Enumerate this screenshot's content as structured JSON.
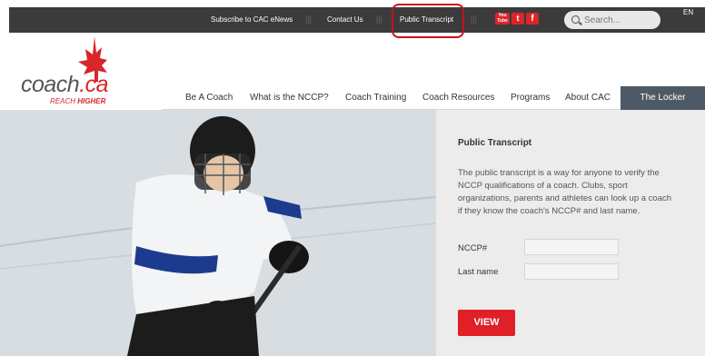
{
  "topbar": {
    "subscribe": "Subscribe to CAC eNews",
    "contact": "Contact Us",
    "transcript": "Public Transcript",
    "separator": "|||",
    "youtube": "You Tube",
    "twitter": "t",
    "facebook": "f",
    "search_placeholder": "Search...",
    "language": "EN"
  },
  "logo": {
    "word": "coach",
    "suffix": ".ca",
    "tag_a": "REACH ",
    "tag_b": "HIGHER"
  },
  "nav": [
    "Be A Coach",
    "What is the NCCP?",
    "Coach Training",
    "Coach Resources",
    "Programs",
    "About CAC",
    "The Locker"
  ],
  "panel": {
    "title": "Public Transcript",
    "description": "The public transcript is a way for anyone to verify the NCCP qualifications of a coach. Clubs, sport organizations, parents and athletes can look up a coach if they know the coach's NCCP# and last name.",
    "nccp_label": "NCCP#",
    "lastname_label": "Last name",
    "view_button": "VIEW"
  },
  "colors": {
    "brand_red": "#d9262a",
    "topbar": "#3b3b3b",
    "locker": "#4d5a66"
  }
}
